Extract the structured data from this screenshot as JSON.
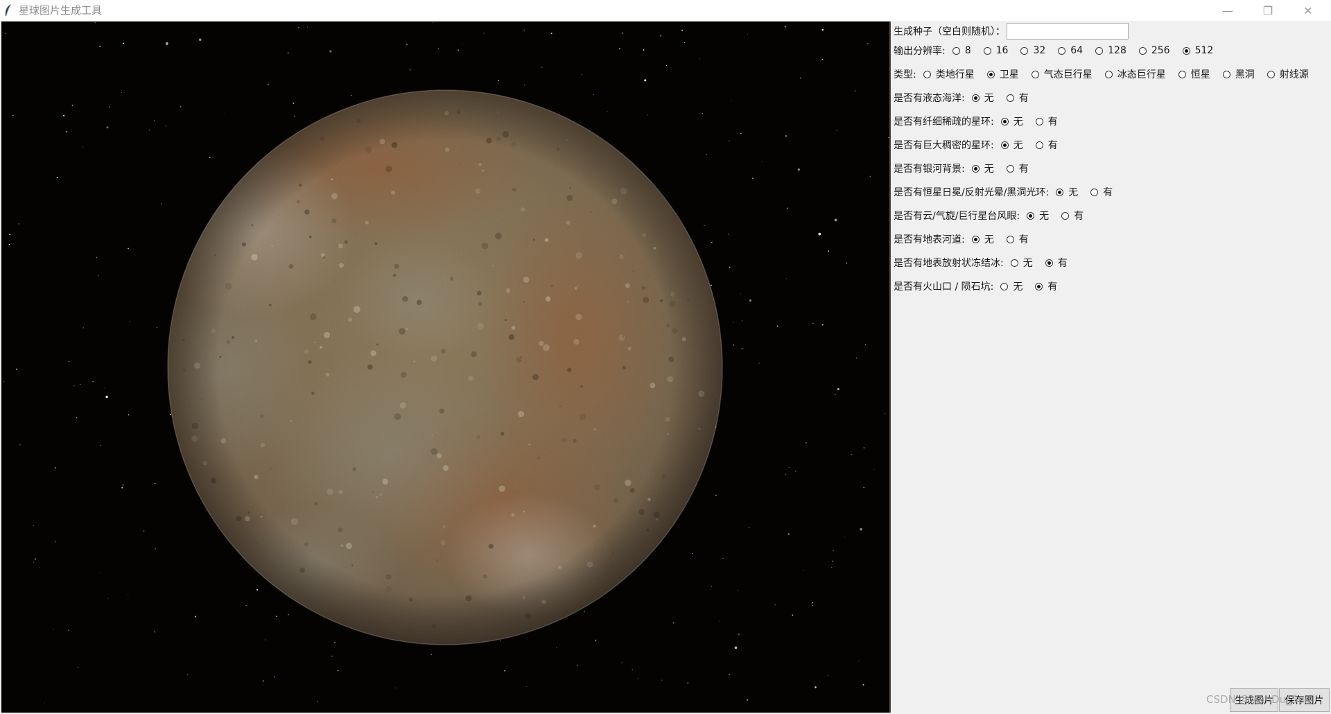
{
  "window": {
    "title": "星球图片生成工具",
    "controls": {
      "minimize": "—",
      "maximize": "❐",
      "close": "✕"
    }
  },
  "controls": {
    "seed": {
      "label": "生成种子（空白则随机）：",
      "value": ""
    },
    "resolution": {
      "label": "输出分辨率:",
      "options": [
        "8",
        "16",
        "32",
        "64",
        "128",
        "256",
        "512"
      ],
      "selected": "512"
    },
    "type": {
      "label": "类型:",
      "options": [
        "类地行星",
        "卫星",
        "气态巨行星",
        "冰态巨行星",
        "恒星",
        "黑洞",
        "射线源"
      ],
      "selected": "卫星"
    },
    "toggles": [
      {
        "label": "是否有液态海洋:",
        "options": [
          "无",
          "有"
        ],
        "selected": "无"
      },
      {
        "label": "是否有纤细稀疏的星环:",
        "options": [
          "无",
          "有"
        ],
        "selected": "无"
      },
      {
        "label": "是否有巨大稠密的星环:",
        "options": [
          "无",
          "有"
        ],
        "selected": "无"
      },
      {
        "label": "是否有银河背景:",
        "options": [
          "无",
          "有"
        ],
        "selected": "无"
      },
      {
        "label": "是否有恒星日冕/反射光晕/黑洞光环:",
        "options": [
          "无",
          "有"
        ],
        "selected": "无"
      },
      {
        "label": "是否有云/气旋/巨行星台风眼:",
        "options": [
          "无",
          "有"
        ],
        "selected": "无"
      },
      {
        "label": "是否有地表河道:",
        "options": [
          "无",
          "有"
        ],
        "selected": "无"
      },
      {
        "label": "是否有地表放射状冻结冰:",
        "options": [
          "无",
          "有"
        ],
        "selected": "有"
      },
      {
        "label": "是否有火山口 / 陨石坑:",
        "options": [
          "无",
          "有"
        ],
        "selected": "有"
      }
    ]
  },
  "buttons": {
    "generate": "生成图片",
    "save": "保存图片"
  },
  "watermark": "CSDN @ManDu_Sun"
}
